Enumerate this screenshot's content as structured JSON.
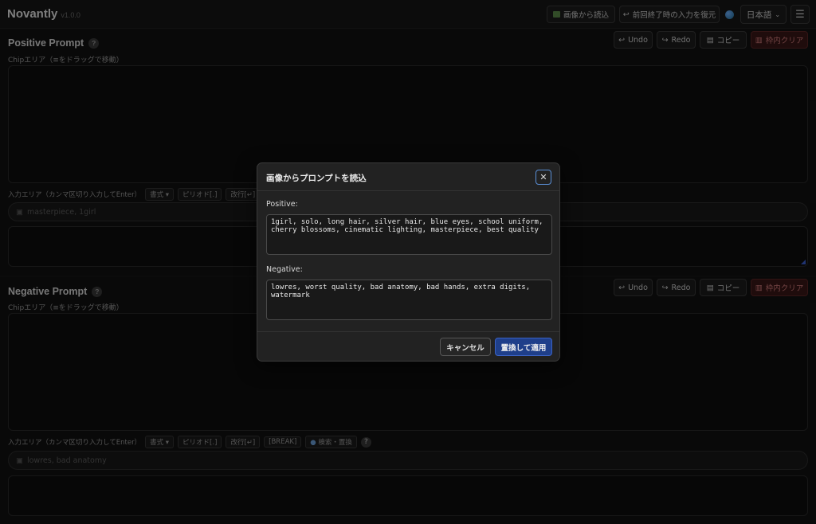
{
  "header": {
    "app_name": "Novantly",
    "version": "v1.0.0",
    "load_from_image": "画像から読込",
    "restore_last": "前回終了時の入力を復元",
    "language": "日本語"
  },
  "positive": {
    "title": "Positive Prompt",
    "undo": "Undo",
    "redo": "Redo",
    "copy": "コピー",
    "clear": "枠内クリア",
    "chip_hint": "Chipエリア（≡をドラッグで移動）",
    "input_hint": "入力エリア（カンマ区切り入力してEnter）",
    "format": "書式",
    "period": "ピリオド[.]",
    "newline": "改行[↵]",
    "placeholder": "masterpiece, 1girl"
  },
  "negative": {
    "title": "Negative Prompt",
    "undo": "Undo",
    "redo": "Redo",
    "copy": "コピー",
    "clear": "枠内クリア",
    "chip_hint": "Chipエリア（≡をドラッグで移動）",
    "input_hint": "入力エリア（カンマ区切り入力してEnter）",
    "format": "書式",
    "period": "ピリオド[.]",
    "newline": "改行[↵]",
    "break": "[BREAK]",
    "search_replace": "検索・置換",
    "placeholder": "lowres, bad anatomy"
  },
  "modal": {
    "title": "画像からプロンプトを読込",
    "positive_label": "Positive:",
    "positive_text": "1girl, solo, long hair, silver hair, blue eyes, school uniform, cherry blossoms, cinematic lighting, masterpiece, best quality",
    "negative_label": "Negative:",
    "negative_text": "lowres, worst quality, bad anatomy, bad hands, extra digits, watermark",
    "cancel": "キャンセル",
    "apply": "置換して適用"
  }
}
